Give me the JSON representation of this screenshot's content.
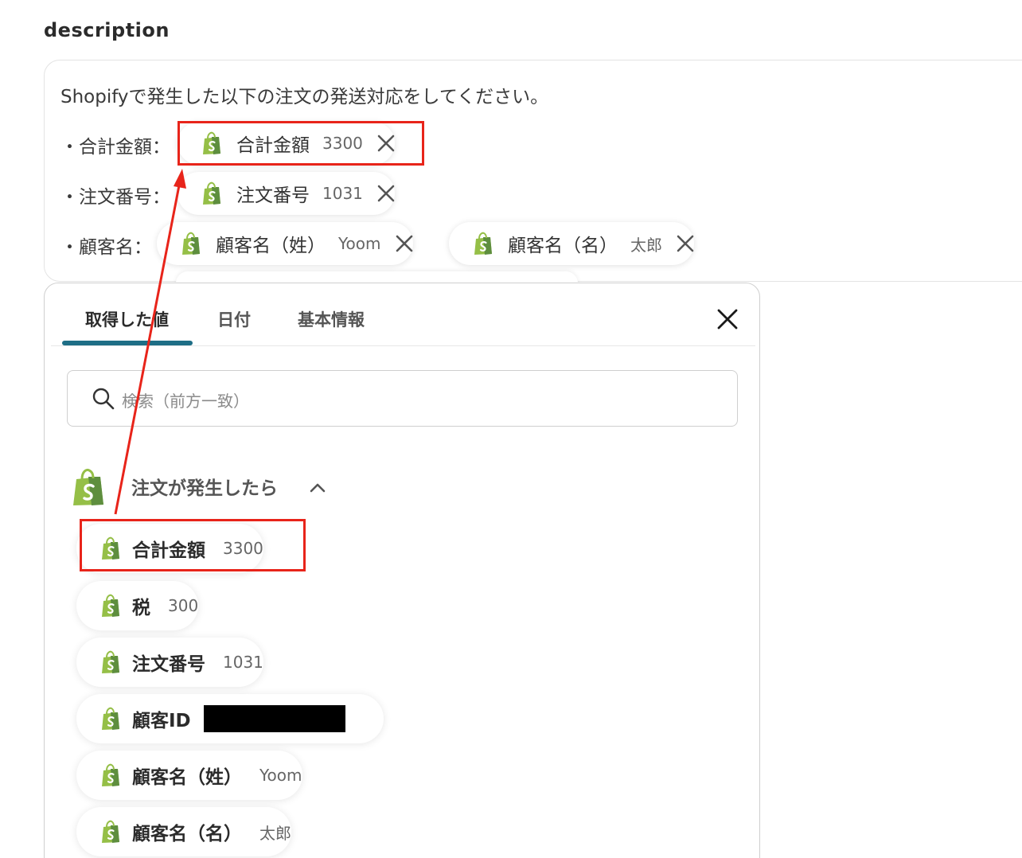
{
  "field_label": "description",
  "description": {
    "intro": "Shopifyで発生した以下の注文の発送対応をしてください。",
    "rows": [
      {
        "label": "・合計金額："
      },
      {
        "label": "・注文番号："
      },
      {
        "label": "・顧客名："
      }
    ],
    "chips": [
      {
        "name": "合計金額",
        "value": "3300"
      },
      {
        "name": "注文番号",
        "value": "1031"
      },
      {
        "name": "顧客名（姓）",
        "value": "Yoom"
      },
      {
        "name": "顧客名（名）",
        "value": "太郎"
      }
    ]
  },
  "popover": {
    "tabs": [
      {
        "label": "取得した値",
        "active": true
      },
      {
        "label": "日付",
        "active": false
      },
      {
        "label": "基本情報",
        "active": false
      }
    ],
    "search_placeholder": "検索（前方一致）",
    "group_title": "注文が発生したら",
    "items": [
      {
        "name": "合計金額",
        "value": "3300"
      },
      {
        "name": "税",
        "value": "300"
      },
      {
        "name": "注文番号",
        "value": "1031"
      },
      {
        "name": "顧客ID",
        "value": ""
      },
      {
        "name": "顧客名（姓）",
        "value": "Yoom"
      },
      {
        "name": "顧客名（名）",
        "value": "太郎"
      }
    ]
  },
  "colors": {
    "accent_tab": "#1e6e86",
    "highlight": "#e8241a",
    "shopify_green": "#95bf47",
    "shopify_dark": "#5e8e3e"
  },
  "icons": [
    "shopify-icon",
    "close-icon",
    "search-icon",
    "chevron-up-icon",
    "arrow-annotation"
  ]
}
